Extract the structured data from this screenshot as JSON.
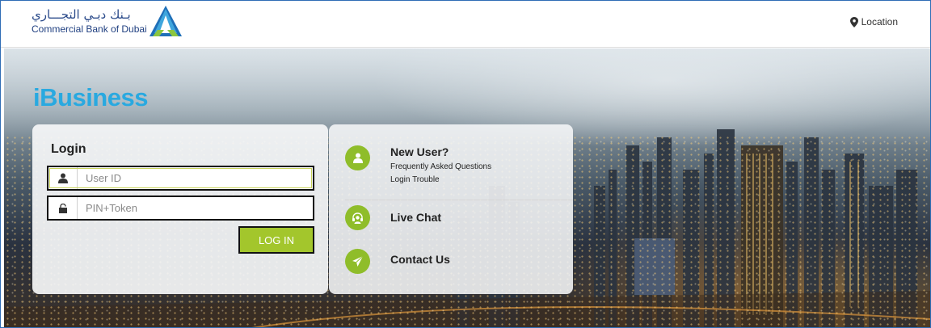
{
  "header": {
    "logo_arabic": "بـنك دبـي التجـــاري",
    "logo_english": "Commercial Bank of Dubai",
    "location_label": "Location"
  },
  "brand": {
    "prefix": "i",
    "name": "Business"
  },
  "login": {
    "title": "Login",
    "user_id_placeholder": "User ID",
    "pin_placeholder": "PIN+Token",
    "button_label": "LOG IN"
  },
  "help": {
    "new_user": {
      "title": "New User?",
      "links": [
        "Frequently Asked Questions",
        "Login Trouble"
      ]
    },
    "live_chat": {
      "title": "Live Chat"
    },
    "contact_us": {
      "title": "Contact Us"
    }
  },
  "colors": {
    "brand_blue": "#29a9e0",
    "accent_green": "#a3c62c",
    "icon_green": "#8fbd2a",
    "logo_navy": "#1f3f80"
  },
  "icons": {
    "location": "map-pin-icon",
    "user": "user-icon",
    "pin": "lock-icon",
    "new_user": "person-icon",
    "live_chat": "headset-icon",
    "contact_us": "paper-plane-icon"
  }
}
